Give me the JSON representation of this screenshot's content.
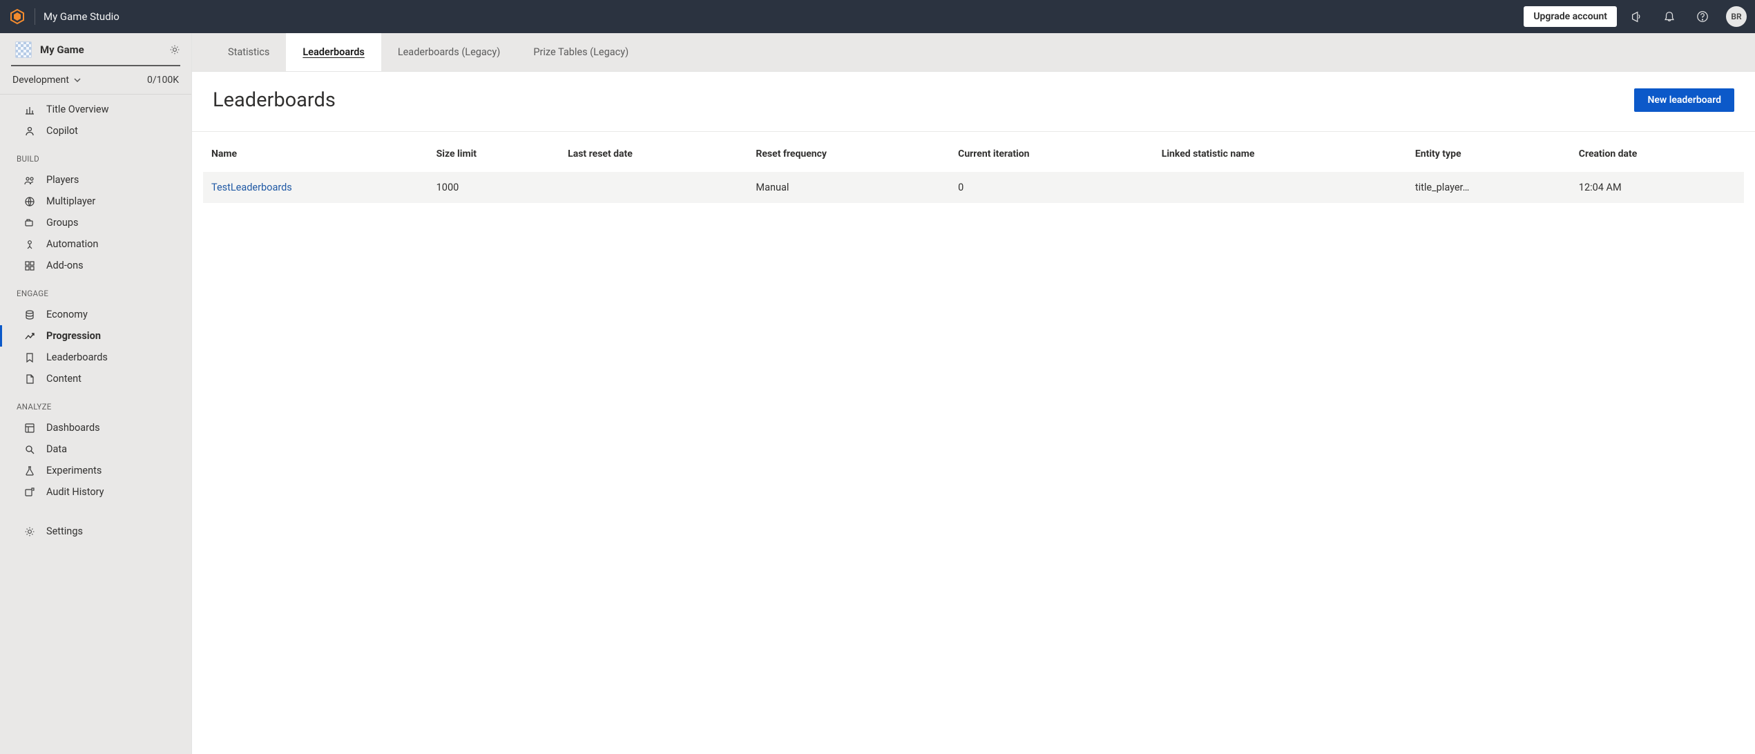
{
  "topbar": {
    "studio_name": "My Game Studio",
    "upgrade_label": "Upgrade account",
    "avatar_initials": "BR"
  },
  "sidebar": {
    "game_name": "My Game",
    "environment_label": "Development",
    "quota": "0/100K",
    "items": [
      {
        "id": "title-overview",
        "label": "Title Overview"
      },
      {
        "id": "copilot",
        "label": "Copilot"
      }
    ],
    "groups": {
      "build_label": "BUILD",
      "build": [
        {
          "id": "players",
          "label": "Players"
        },
        {
          "id": "multiplayer",
          "label": "Multiplayer"
        },
        {
          "id": "groups",
          "label": "Groups"
        },
        {
          "id": "automation",
          "label": "Automation"
        },
        {
          "id": "addons",
          "label": "Add-ons"
        }
      ],
      "engage_label": "ENGAGE",
      "engage": [
        {
          "id": "economy",
          "label": "Economy"
        },
        {
          "id": "progression",
          "label": "Progression"
        },
        {
          "id": "leaderboards",
          "label": "Leaderboards"
        },
        {
          "id": "content",
          "label": "Content"
        }
      ],
      "analyze_label": "ANALYZE",
      "analyze": [
        {
          "id": "dashboards",
          "label": "Dashboards"
        },
        {
          "id": "data",
          "label": "Data"
        },
        {
          "id": "experiments",
          "label": "Experiments"
        },
        {
          "id": "audit",
          "label": "Audit History"
        }
      ]
    },
    "settings_label": "Settings"
  },
  "tabs": [
    {
      "id": "statistics",
      "label": "Statistics"
    },
    {
      "id": "leaderboards",
      "label": "Leaderboards"
    },
    {
      "id": "leaderboards-legacy",
      "label": "Leaderboards (Legacy)"
    },
    {
      "id": "prize-tables-legacy",
      "label": "Prize Tables (Legacy)"
    }
  ],
  "page": {
    "title": "Leaderboards",
    "new_button_label": "New leaderboard"
  },
  "table": {
    "columns": {
      "name": "Name",
      "size_limit": "Size limit",
      "last_reset": "Last reset date",
      "reset_freq": "Reset frequency",
      "current_iter": "Current iteration",
      "linked_stat": "Linked statistic name",
      "entity_type": "Entity type",
      "creation_date": "Creation date"
    },
    "rows": [
      {
        "name": "TestLeaderboards",
        "size_limit": "1000",
        "last_reset": "",
        "reset_freq": "Manual",
        "current_iter": "0",
        "linked_stat": "",
        "entity_type": "title_player…",
        "creation_date": "12:04 AM"
      }
    ]
  }
}
